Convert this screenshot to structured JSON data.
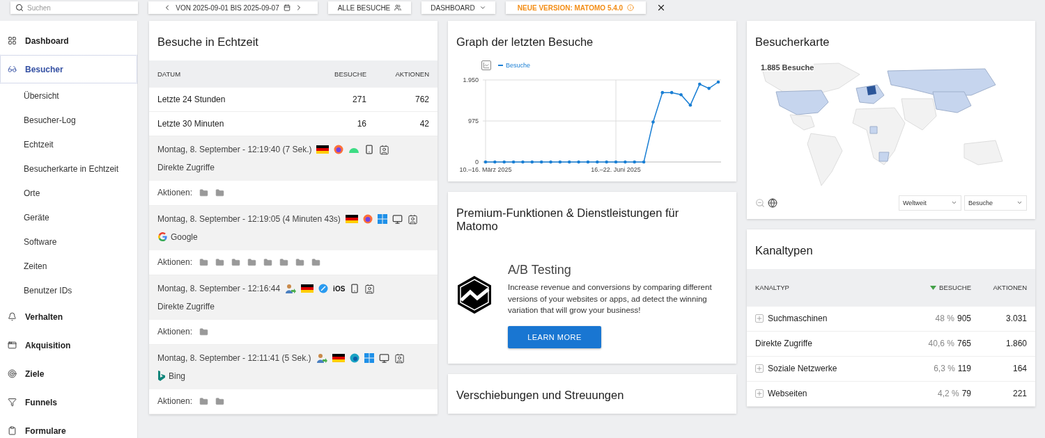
{
  "top_bar": {
    "search": {
      "placeholder": "Suchen"
    },
    "date_range": "VON 2025-09-01 BIS 2025-09-07",
    "segment": "ALLE BESUCHE",
    "dashboard_menu": "DASHBOARD",
    "update_notice": "NEUE VERSION: MATOMO 5.4.0"
  },
  "sidebar": {
    "items": [
      {
        "kind": "dashboard",
        "label": "Dashboard",
        "selected": false
      },
      {
        "kind": "visitors",
        "label": "Besucher",
        "selected": true,
        "children": [
          {
            "label": "Übersicht",
            "selected": false
          },
          {
            "label": "Besucher-Log",
            "selected": false
          },
          {
            "label": "Echtzeit",
            "selected": false
          },
          {
            "label": "Besucherkarte in Echtzeit",
            "selected": false
          },
          {
            "label": "Orte",
            "selected": false
          },
          {
            "label": "Geräte",
            "selected": false
          },
          {
            "label": "Software",
            "selected": false
          },
          {
            "label": "Zeiten",
            "selected": false
          },
          {
            "label": "Benutzer IDs",
            "selected": false
          }
        ]
      },
      {
        "kind": "behaviour",
        "label": "Verhalten",
        "selected": false
      },
      {
        "kind": "acquisition",
        "label": "Akquisition",
        "selected": false
      },
      {
        "kind": "goals",
        "label": "Ziele",
        "selected": false
      },
      {
        "kind": "funnels",
        "label": "Funnels",
        "selected": false
      },
      {
        "kind": "forms",
        "label": "Formulare",
        "selected": false
      }
    ]
  },
  "realtime": {
    "title": "Besuche in Echtzeit",
    "columns": [
      "DATUM",
      "BESUCHE",
      "AKTIONEN"
    ],
    "rows": [
      {
        "period": "Letzte 24 Stunden",
        "visits": "271",
        "actions": "762"
      },
      {
        "period": "Letzte 30 Minuten",
        "visits": "16",
        "actions": "42"
      }
    ],
    "visits": [
      {
        "datetime": "Montag, 8. September - 12:19:40 (7 Sek.)",
        "actions_label": "Aktionen:",
        "icons": [
          {
            "kind": "flag"
          },
          {
            "kind": "firefox"
          },
          {
            "kind": "android"
          },
          {
            "kind": "phone"
          },
          {
            "kind": "profile"
          }
        ],
        "referrer": {
          "kind": "direct",
          "label": "Direkte Zugriffe"
        },
        "actions": [
          {
            "kind": "page"
          },
          {
            "kind": "page"
          }
        ]
      },
      {
        "datetime": "Montag, 8. September - 12:19:05 (4 Minuten 43s)",
        "actions_label": "Aktionen:",
        "icons": [
          {
            "kind": "flag"
          },
          {
            "kind": "firefox"
          },
          {
            "kind": "windows"
          },
          {
            "kind": "desktop"
          },
          {
            "kind": "profile"
          }
        ],
        "referrer": {
          "kind": "google",
          "label": "Google"
        },
        "actions": [
          {
            "kind": "page"
          },
          {
            "kind": "page"
          },
          {
            "kind": "page"
          },
          {
            "kind": "page"
          },
          {
            "kind": "page"
          },
          {
            "kind": "page"
          },
          {
            "kind": "page"
          },
          {
            "kind": "page"
          }
        ]
      },
      {
        "datetime": "Montag, 8. September - 12:16:44",
        "actions_label": "Aktionen:",
        "icons": [
          {
            "kind": "returning"
          },
          {
            "kind": "flag"
          },
          {
            "kind": "safari"
          },
          {
            "kind": "text",
            "text": "iOS"
          },
          {
            "kind": "phone"
          },
          {
            "kind": "profile"
          }
        ],
        "referrer": {
          "kind": "direct",
          "label": "Direkte Zugriffe"
        },
        "actions": [
          {
            "kind": "page"
          }
        ]
      },
      {
        "datetime": "Montag, 8. September - 12:11:41 (5 Sek.)",
        "actions_label": "Aktionen:",
        "icons": [
          {
            "kind": "returning"
          },
          {
            "kind": "flag"
          },
          {
            "kind": "edge"
          },
          {
            "kind": "windows"
          },
          {
            "kind": "desktop"
          },
          {
            "kind": "profile"
          }
        ],
        "referrer": {
          "kind": "bing",
          "label": "Bing"
        },
        "actions": [
          {
            "kind": "page"
          },
          {
            "kind": "page"
          }
        ]
      }
    ]
  },
  "graph": {
    "title": "Graph der letzten Besuche",
    "chart_data": {
      "type": "line",
      "series": [
        {
          "name": "Besuche",
          "color": "#1a7fd4",
          "values": [
            0,
            0,
            0,
            0,
            0,
            0,
            0,
            0,
            0,
            0,
            0,
            0,
            0,
            0,
            0,
            0,
            0,
            0,
            950,
            1650,
            1650,
            1600,
            1350,
            1850,
            1750,
            1900
          ]
        }
      ],
      "categories": [
        "10.–16. März 2025",
        null,
        null,
        null,
        null,
        null,
        null,
        null,
        null,
        null,
        null,
        null,
        null,
        null,
        "16.–22. Juni 2025",
        null,
        null,
        null,
        null,
        null,
        null,
        null,
        null,
        null,
        null,
        null
      ],
      "grid": true,
      "ylim": [
        0,
        1950
      ],
      "yticks": [
        {
          "value": 0,
          "label": "0"
        },
        {
          "value": 975,
          "label": "975"
        },
        {
          "value": 1950,
          "label": "1.950"
        }
      ]
    }
  },
  "premium": {
    "title": "Premium-Funktionen & Dienstleistungen für Matomo",
    "product": "A/B Testing",
    "description": "Increase revenue and conversions by comparing different versions of your websites or apps, ad detect the winning variation that will grow your business!",
    "button": "LEARN MORE"
  },
  "transitions": {
    "title": "Verschiebungen und Streuungen"
  },
  "visitor_map": {
    "title": "Besucherkarte",
    "total": "1.885 Besuche",
    "region": "Weltweit",
    "metric": "Besuche"
  },
  "channels": {
    "title": "Kanaltypen",
    "columns": [
      {
        "label": "KANALTYP",
        "sorted": false
      },
      {
        "label": "BESUCHE",
        "sorted": true
      },
      {
        "label": "AKTIONEN",
        "sorted": false
      }
    ],
    "rows": [
      {
        "label": "Suchmaschinen",
        "expandable": true,
        "share": "48 %",
        "visits": "905",
        "actions": "3.031"
      },
      {
        "label": "Direkte Zugriffe",
        "expandable": false,
        "share": "40,6 %",
        "visits": "765",
        "actions": "1.860"
      },
      {
        "label": "Soziale Netzwerke",
        "expandable": true,
        "share": "6,3 %",
        "visits": "119",
        "actions": "164"
      },
      {
        "label": "Webseiten",
        "expandable": true,
        "share": "4,2 %",
        "visits": "79",
        "actions": "221"
      }
    ]
  }
}
